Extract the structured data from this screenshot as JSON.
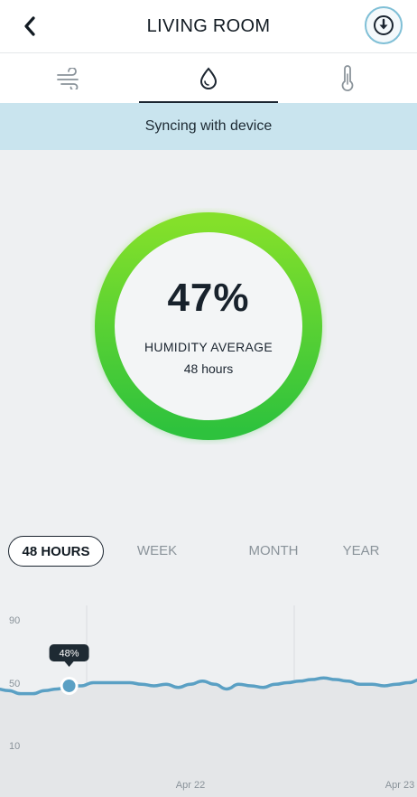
{
  "header": {
    "title": "LIVING ROOM",
    "back_icon": "chevron-left-icon",
    "download_icon": "download-circle-icon"
  },
  "tabs": [
    {
      "icon": "wind-icon",
      "active": false
    },
    {
      "icon": "water-drop-icon",
      "active": true
    },
    {
      "icon": "thermometer-icon",
      "active": false
    }
  ],
  "banner": {
    "text": "Syncing with device"
  },
  "gauge": {
    "value": "47%",
    "label": "HUMIDITY AVERAGE",
    "period": "48 hours",
    "colors": {
      "top": "#84e02a",
      "bottom": "#2ec23d"
    }
  },
  "range_tabs": [
    {
      "label": "48 HOURS",
      "active": true
    },
    {
      "label": "WEEK",
      "active": false
    },
    {
      "label": "MONTH",
      "active": false
    },
    {
      "label": "YEAR",
      "active": false
    }
  ],
  "chart_data": {
    "type": "area",
    "y_ticks": [
      "90",
      "50",
      "10"
    ],
    "ylim": [
      0,
      100
    ],
    "x_labels": [
      "Apr 22",
      "Apr 23"
    ],
    "series": [
      {
        "color": "#5aa0c4",
        "values": [
          46,
          45,
          43,
          43,
          45,
          46,
          48,
          48,
          50,
          50,
          50,
          50,
          49,
          48,
          49,
          47,
          49,
          51,
          49,
          46,
          49,
          48,
          47,
          49,
          50,
          51,
          52,
          53,
          52,
          51,
          49,
          49,
          48,
          49,
          50,
          52
        ]
      }
    ],
    "tooltip": {
      "label": "48%",
      "point_index": 6
    }
  }
}
